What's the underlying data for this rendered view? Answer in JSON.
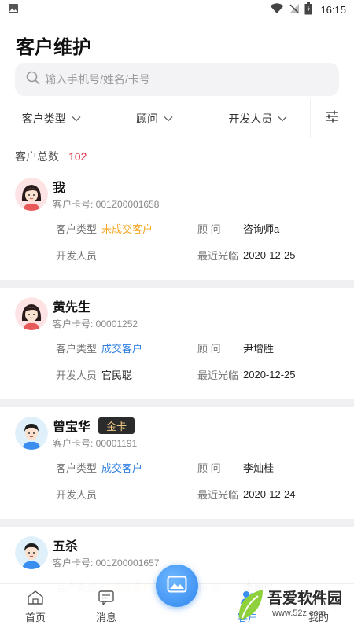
{
  "status_bar": {
    "time": "16:15"
  },
  "page": {
    "title": "客户维护"
  },
  "search": {
    "placeholder": "输入手机号/姓名/卡号"
  },
  "filters": [
    {
      "label": "客户类型"
    },
    {
      "label": "顾问"
    },
    {
      "label": "开发人员"
    }
  ],
  "summary": {
    "label": "客户总数",
    "count": "102"
  },
  "field_labels": {
    "type": "客户类型",
    "advisor": "顾 问",
    "developer": "开发人员",
    "last_visit": "最近光临"
  },
  "customers": [
    {
      "name": "我",
      "badge": "",
      "card_no": "客户卡号: 001Z00001658",
      "type": "未成交客户",
      "type_status": "orange",
      "advisor": "咨询师a",
      "developer": "",
      "last_visit": "2020-12-25",
      "avatar": "female-avatar"
    },
    {
      "name": "黄先生",
      "badge": "",
      "card_no": "客户卡号: 00001252",
      "type": "成交客户",
      "type_status": "blue",
      "advisor": "尹增胜",
      "developer": "官民聪",
      "last_visit": "2020-12-25",
      "avatar": "female-avatar"
    },
    {
      "name": "曾宝华",
      "badge": "金卡",
      "card_no": "客户卡号: 00001191",
      "type": "成交客户",
      "type_status": "blue",
      "advisor": "李灿桂",
      "developer": "",
      "last_visit": "2020-12-24",
      "avatar": "male-avatar"
    },
    {
      "name": "五杀",
      "badge": "",
      "card_no": "客户卡号: 001Z00001657",
      "type": "未成交客户",
      "type_status": "orange",
      "advisor": "李丽仪",
      "developer": "",
      "last_visit": "",
      "avatar": "male-avatar"
    }
  ],
  "bottom_nav": [
    {
      "label": "首页",
      "icon": "home-icon"
    },
    {
      "label": "消息",
      "icon": "message-icon"
    },
    {
      "label": "客户",
      "icon": "customer-icon",
      "active": true
    },
    {
      "label": "我的",
      "icon": "profile-icon"
    }
  ],
  "watermark": {
    "title": "吾爱软件园",
    "url": "www.52z.com"
  },
  "colors": {
    "accent": "#2f86ee",
    "orange": "#f5a623",
    "blue": "#2f7fe0",
    "count_red": "#e23a4a",
    "badge_bg": "#2b2b2b",
    "badge_text": "#f0c986"
  }
}
